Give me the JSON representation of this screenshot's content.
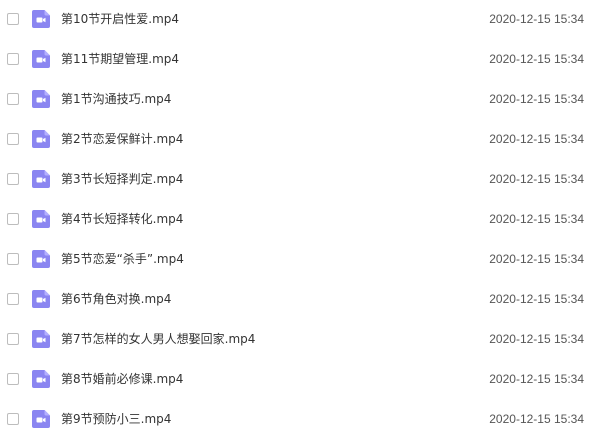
{
  "colors": {
    "video_icon": "#8a85f1",
    "video_icon_glyph": "#ffffff",
    "checkbox_border": "#bdbdbd"
  },
  "icons": {
    "file_type": "video-file-icon",
    "select": "checkbox"
  },
  "files": [
    {
      "name": "第10节开启性爱.mp4",
      "modified": "2020-12-15 15:34"
    },
    {
      "name": "第11节期望管理.mp4",
      "modified": "2020-12-15 15:34"
    },
    {
      "name": "第1节沟通技巧.mp4",
      "modified": "2020-12-15 15:34"
    },
    {
      "name": "第2节恋爱保鲜计.mp4",
      "modified": "2020-12-15 15:34"
    },
    {
      "name": "第3节长短择判定.mp4",
      "modified": "2020-12-15 15:34"
    },
    {
      "name": "第4节长短择转化.mp4",
      "modified": "2020-12-15 15:34"
    },
    {
      "name": "第5节恋爱“杀手”.mp4",
      "modified": "2020-12-15 15:34"
    },
    {
      "name": "第6节角色对换.mp4",
      "modified": "2020-12-15 15:34"
    },
    {
      "name": "第7节怎样的女人男人想娶回家.mp4",
      "modified": "2020-12-15 15:34"
    },
    {
      "name": "第8节婚前必修课.mp4",
      "modified": "2020-12-15 15:34"
    },
    {
      "name": "第9节预防小三.mp4",
      "modified": "2020-12-15 15:34"
    }
  ]
}
